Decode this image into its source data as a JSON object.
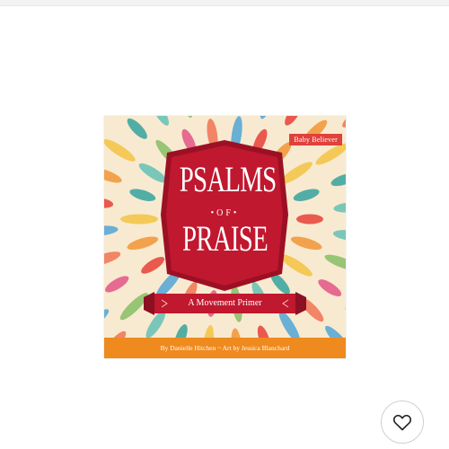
{
  "book": {
    "series_badge": "Baby Believer",
    "title_line1": "PSALMS",
    "title_of": "•OF•",
    "title_line2": "PRAISE",
    "subtitle": "A Movement Primer",
    "credits": "By Danielle Hitchen ~ Art by Jessica Blanchard"
  },
  "favorite_button": {
    "icon": "heart-outline-icon"
  },
  "colors": {
    "cover_background": "#f8ead0",
    "banner_red": "#c0182f",
    "badge_red": "#e0413b",
    "credits_orange": "#ef8a1e"
  }
}
